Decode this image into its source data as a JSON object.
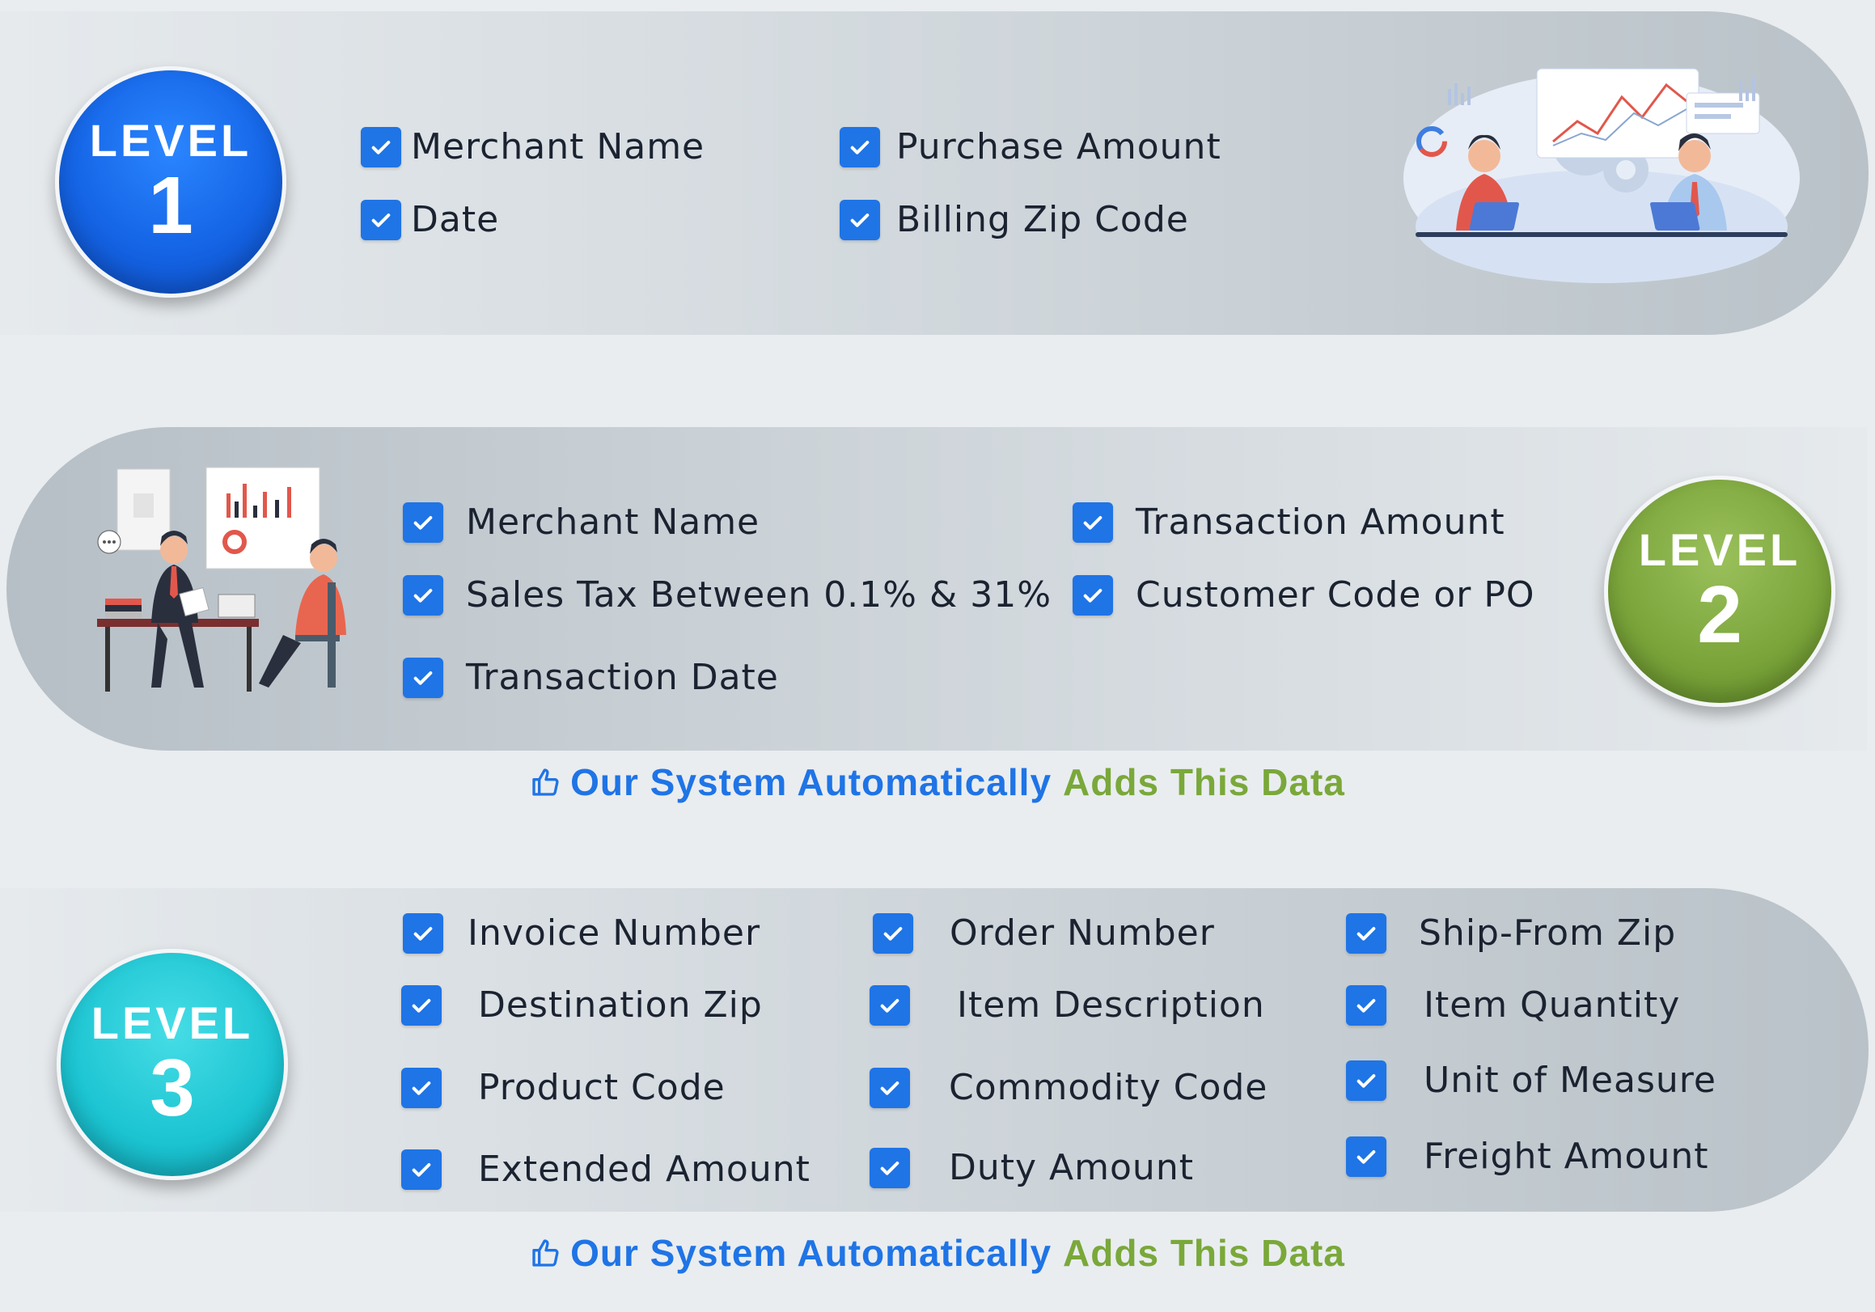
{
  "level1": {
    "badge_word": "LEVEL",
    "badge_number": "1",
    "items": [
      "Merchant Name",
      "Date",
      "Purchase Amount",
      "Billing Zip Code"
    ]
  },
  "level2": {
    "badge_word": "LEVEL",
    "badge_number": "2",
    "items": [
      "Merchant Name",
      "Sales Tax Between 0.1% & 31%",
      "Transaction Date",
      "Transaction Amount",
      "Customer Code or PO"
    ]
  },
  "level3": {
    "badge_word": "LEVEL",
    "badge_number": "3",
    "items": [
      "Invoice Number",
      "Destination Zip",
      "Product Code",
      "Extended Amount",
      "Order Number",
      "Item Description",
      "Commodity Code",
      "Duty Amount",
      "Ship-From Zip",
      "Item Quantity",
      "Unit of Measure",
      "Freight Amount"
    ]
  },
  "tagline": {
    "blue_text": "Our System Automatically",
    "green_text": "Adds This Data",
    "icon": "thumbs-up-icon"
  },
  "colors": {
    "checkbox": "#1f74e6",
    "level1": "#1565e6",
    "level2": "#7aa43a",
    "level3": "#1cc4d2",
    "tag_blue": "#1f74e6",
    "tag_green": "#7aa83a"
  }
}
